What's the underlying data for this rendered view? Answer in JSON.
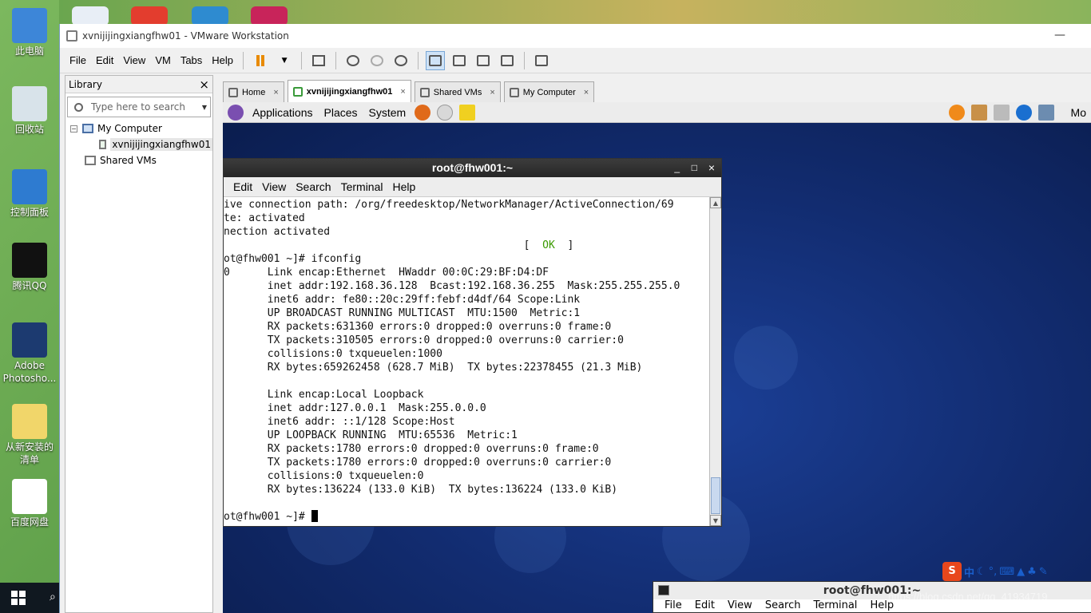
{
  "desktop": {
    "icons": [
      {
        "label": "此电脑",
        "color": "#3d86d8"
      },
      {
        "label": "回收站",
        "color": "#d8e3ea"
      },
      {
        "label": "控制面板",
        "color": "#2e7bd0"
      },
      {
        "label": "腾讯QQ",
        "color": "#111111"
      },
      {
        "label": "Adobe Photosho...",
        "color": "#1c3a70"
      },
      {
        "label": "从新安装的清单",
        "color": "#f1d66a"
      },
      {
        "label": "百度网盘",
        "color": "#ffffff"
      }
    ]
  },
  "vmware": {
    "title": "xvnijijingxiangfhw01 - VMware Workstation",
    "minimize": "—",
    "menu": [
      "File",
      "Edit",
      "View",
      "VM",
      "Tabs",
      "Help"
    ],
    "library": {
      "title": "Library",
      "close": "×",
      "search_placeholder": "Type here to search",
      "tree": {
        "root": "My Computer",
        "vm": "xvnijijingxiangfhw01",
        "shared": "Shared VMs"
      }
    },
    "tabs": [
      {
        "label": "Home",
        "close": "×"
      },
      {
        "label": "xvnijijingxiangfhw01",
        "close": "×"
      },
      {
        "label": "Shared VMs",
        "close": "×"
      },
      {
        "label": "My Computer",
        "close": "×"
      }
    ]
  },
  "guest": {
    "panel_menu": [
      "Applications",
      "Places",
      "System"
    ],
    "panel_right_text": "Mo",
    "terminal": {
      "title": "root@fhw001:~",
      "win_buttons": [
        "_",
        "□",
        "×"
      ],
      "menu": [
        "Edit",
        "View",
        "Search",
        "Terminal",
        "Help"
      ],
      "lines": [
        "ive connection path: /org/freedesktop/NetworkManager/ActiveConnection/69",
        "te: activated",
        "nection activated",
        "",
        "ot@fhw001 ~]# ifconfig",
        "0      Link encap:Ethernet  HWaddr 00:0C:29:BF:D4:DF",
        "       inet addr:192.168.36.128  Bcast:192.168.36.255  Mask:255.255.255.0",
        "       inet6 addr: fe80::20c:29ff:febf:d4df/64 Scope:Link",
        "       UP BROADCAST RUNNING MULTICAST  MTU:1500  Metric:1",
        "       RX packets:631360 errors:0 dropped:0 overruns:0 frame:0",
        "       TX packets:310505 errors:0 dropped:0 overruns:0 carrier:0",
        "       collisions:0 txqueuelen:1000",
        "       RX bytes:659262458 (628.7 MiB)  TX bytes:22378455 (21.3 MiB)",
        "",
        "       Link encap:Local Loopback",
        "       inet addr:127.0.0.1  Mask:255.0.0.0",
        "       inet6 addr: ::1/128 Scope:Host",
        "       UP LOOPBACK RUNNING  MTU:65536  Metric:1",
        "       RX packets:1780 errors:0 dropped:0 overruns:0 frame:0",
        "       TX packets:1780 errors:0 dropped:0 overruns:0 carrier:0",
        "       collisions:0 txqueuelen:0",
        "       RX bytes:136224 (133.0 KiB)  TX bytes:136224 (133.0 KiB)",
        ""
      ],
      "ok_prefix": "                                                [  ",
      "ok_text": "OK",
      "ok_suffix": "  ]",
      "prompt": "ot@fhw001 ~]# "
    },
    "terminal2": {
      "title": "root@fhw001:~",
      "menu": [
        "File",
        "Edit",
        "View",
        "Search",
        "Terminal",
        "Help"
      ]
    },
    "ime_text": "中",
    "watermark": "https://blog.csdn.net/qq_41934719"
  }
}
